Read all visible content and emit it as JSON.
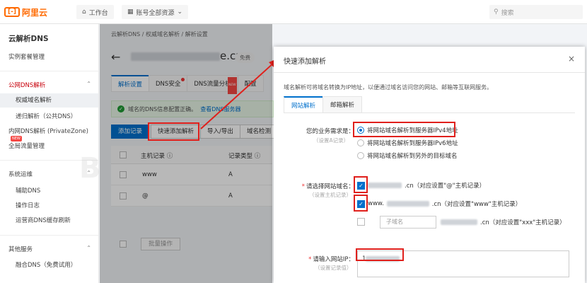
{
  "topbar": {
    "logo_text": "阿里云",
    "workbench_label": "工作台",
    "resources_label": "账号全部资源",
    "search_placeholder": "搜索"
  },
  "sidebar": {
    "title": "云解析DNS",
    "items": [
      {
        "label": "实例套餐管理"
      },
      {
        "label": "公网DNS解析"
      },
      {
        "label": "权威域名解析"
      },
      {
        "label": "递归解析（公共DNS）"
      },
      {
        "label": "内网DNS解析 (PrivateZone)",
        "badge": "NEW"
      },
      {
        "label": "全局流量管理"
      },
      {
        "label": "系统运维"
      },
      {
        "label": "辅助DNS"
      },
      {
        "label": "操作日志"
      },
      {
        "label": "运营商DNS缓存刷新"
      },
      {
        "label": "其他服务"
      },
      {
        "label": "融合DNS（免费试用）"
      }
    ]
  },
  "main": {
    "breadcrumb": "云解析DNS / 权威域名解析 / 解析设置",
    "domain_suffix": "e.cn",
    "pill_label": "免费",
    "tabs": [
      {
        "label": "解析设置"
      },
      {
        "label": "DNS安全"
      },
      {
        "label": "DNS流量分析"
      },
      {
        "label": "配置"
      }
    ],
    "success_text": "域名的DNS信息配置正确。",
    "success_link": "查看DNS服务器",
    "buttons": {
      "add_record": "添加记录",
      "quick_add": "快速添加解析",
      "import_export": "导入/导出",
      "domain_check": "域名检测",
      "batch": "批量操作"
    },
    "table": {
      "headers": [
        "主机记录 ⓘ",
        "记录类型 ⓘ"
      ],
      "rows": [
        {
          "host": "www",
          "type": "A"
        },
        {
          "host": "@",
          "type": "A"
        }
      ]
    }
  },
  "dialog": {
    "title": "快速添加解析",
    "close": "×",
    "description": "域名解析可将域名转换为IP地址，以便通过域名访问您的网站、邮箱等互联网服务。",
    "tabs": [
      {
        "label": "网站解析"
      },
      {
        "label": "邮箱解析"
      }
    ],
    "need_label": "您的业务需求是：",
    "need_hint": "（设置A记录）",
    "need_options": [
      {
        "label": "将网站域名解析到服务器IPv4地址",
        "selected": true
      },
      {
        "label": "将网站域名解析到服务器IPv6地址",
        "selected": false
      },
      {
        "label": "将网站域名解析到另外的目标域名",
        "selected": false
      }
    ],
    "domain_label": "请选择网站域名：",
    "domain_hint": "（设置主机记录）",
    "domain_options": [
      {
        "prefix": "",
        "suffix": ".cn（对应设置\"@\"主机记录）",
        "checked": true
      },
      {
        "prefix": "www.",
        "suffix": ".cn（对应设置\"www\"主机记录）",
        "checked": true
      },
      {
        "prefix": "",
        "suffix": ".cn（对应设置\"xxx\"主机记录）",
        "checked": false
      }
    ],
    "subdomain_placeholder": "子域名",
    "ip_label": "请输入网站IP：",
    "ip_hint": "（设置记录值）",
    "ip_value": "1"
  },
  "colors": {
    "brand": "#ff6a00",
    "primary": "#0070cc",
    "highlight": "#e0201c",
    "success": "#1e9a32"
  }
}
